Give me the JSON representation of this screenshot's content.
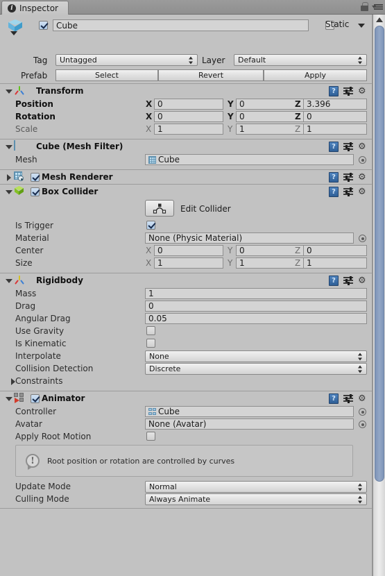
{
  "window": {
    "tab_label": "Inspector",
    "tab_icon": "info-icon",
    "lock_icon": "lock-icon",
    "menu_icon": "hamburger-menu-icon"
  },
  "gameobject": {
    "icon": "cube-icon",
    "enabled": true,
    "name": "Cube",
    "static_label": "Static",
    "static_checked": false,
    "tag_label": "Tag",
    "tag_value": "Untagged",
    "layer_label": "Layer",
    "layer_value": "Default",
    "prefab_label": "Prefab",
    "prefab_select": "Select",
    "prefab_revert": "Revert",
    "prefab_apply": "Apply"
  },
  "header_icons": {
    "help": "?",
    "preset": "preset-icon",
    "gear": "gear-icon"
  },
  "components": {
    "transform": {
      "title": "Transform",
      "icon": "transform-gizmo-icon",
      "expanded": true,
      "rows": [
        {
          "label": "Position",
          "x": "0",
          "y": "0",
          "z": "3.396"
        },
        {
          "label": "Rotation",
          "x": "0",
          "y": "0",
          "z": "0"
        },
        {
          "label": "Scale",
          "x": "1",
          "y": "1",
          "z": "1"
        }
      ],
      "axis_x": "X",
      "axis_y": "Y",
      "axis_z": "Z"
    },
    "mesh_filter": {
      "title": "Cube (Mesh Filter)",
      "icon": "mesh-filter-icon",
      "expanded": true,
      "mesh_label": "Mesh",
      "mesh_value": "Cube"
    },
    "mesh_renderer": {
      "title": "Mesh Renderer",
      "icon": "mesh-renderer-icon",
      "expanded": false,
      "enabled": true
    },
    "box_collider": {
      "title": "Box Collider",
      "icon": "box-collider-icon",
      "expanded": true,
      "enabled": true,
      "edit_collider_label": "Edit Collider",
      "is_trigger_label": "Is Trigger",
      "is_trigger_checked": true,
      "material_label": "Material",
      "material_value": "None (Physic Material)",
      "center_label": "Center",
      "center": {
        "x": "0",
        "y": "0",
        "z": "0"
      },
      "size_label": "Size",
      "size": {
        "x": "1",
        "y": "1",
        "z": "1"
      },
      "axis_x": "X",
      "axis_y": "Y",
      "axis_z": "Z"
    },
    "rigidbody": {
      "title": "Rigidbody",
      "icon": "rigidbody-icon",
      "expanded": true,
      "mass_label": "Mass",
      "mass_value": "1",
      "drag_label": "Drag",
      "drag_value": "0",
      "angular_drag_label": "Angular Drag",
      "angular_drag_value": "0.05",
      "use_gravity_label": "Use Gravity",
      "use_gravity_checked": false,
      "is_kinematic_label": "Is Kinematic",
      "is_kinematic_checked": false,
      "interpolate_label": "Interpolate",
      "interpolate_value": "None",
      "collision_detection_label": "Collision Detection",
      "collision_detection_value": "Discrete",
      "constraints_label": "Constraints",
      "constraints_expanded": false
    },
    "animator": {
      "title": "Animator",
      "icon": "animator-icon",
      "expanded": true,
      "enabled": true,
      "controller_label": "Controller",
      "controller_value": "Cube",
      "avatar_label": "Avatar",
      "avatar_value": "None (Avatar)",
      "apply_root_motion_label": "Apply Root Motion",
      "apply_root_motion_checked": false,
      "info_message": "Root position or rotation are controlled by curves",
      "info_icon": "info-bubble-icon",
      "update_mode_label": "Update Mode",
      "update_mode_value": "Normal",
      "culling_mode_label": "Culling Mode",
      "culling_mode_value": "Always Animate"
    }
  },
  "scrollbar": {
    "up_arrow": "scroll-up-arrow"
  }
}
